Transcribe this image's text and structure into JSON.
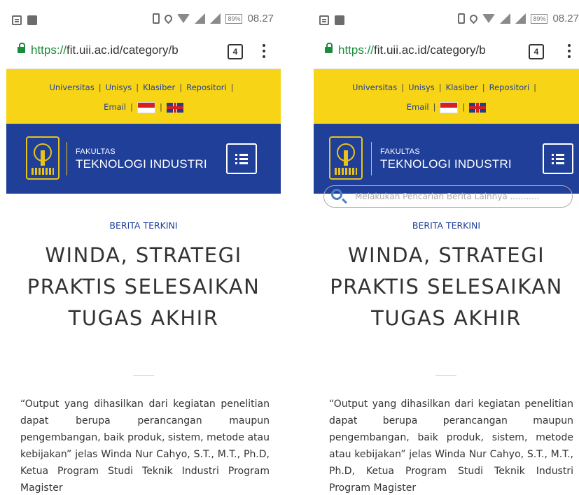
{
  "status_bar": {
    "battery": "89%",
    "time": "08.27"
  },
  "browser": {
    "url_scheme": "https://",
    "url_rest": "fit.uii.ac.id/category/b",
    "tab_count": "4"
  },
  "top_nav": {
    "items": [
      "Universitas",
      "Unisys",
      "Klasiber",
      "Repositori",
      "Email"
    ],
    "separator": "|"
  },
  "header": {
    "line1": "FAKULTAS",
    "line2": "TEKNOLOGI INDUSTRI"
  },
  "search": {
    "placeholder": "Melakukan Pencarian Berita Lainnya ..........."
  },
  "article": {
    "kicker": "BERITA TERKINI",
    "title": "WINDA, STRATEGI PRAKTIS SELESAIKAN TUGAS AKHIR",
    "body": "“Output yang dihasilkan dari kegiatan penelitian dapat berupa perancangan maupun pengembangan, baik produk, sistem, metode atau kebijakan” jelas Winda Nur Cahyo, S.T., M.T., Ph.D, Ketua Program Studi Teknik Industri Program Magister"
  },
  "colors": {
    "yellow": "#f7d416",
    "blue": "#1f3f99"
  },
  "icons": [
    "lock-icon",
    "tab-switcher-icon",
    "menu-dots-icon",
    "hamburger-icon",
    "search-icon",
    "flag-id-icon",
    "flag-uk-icon"
  ]
}
